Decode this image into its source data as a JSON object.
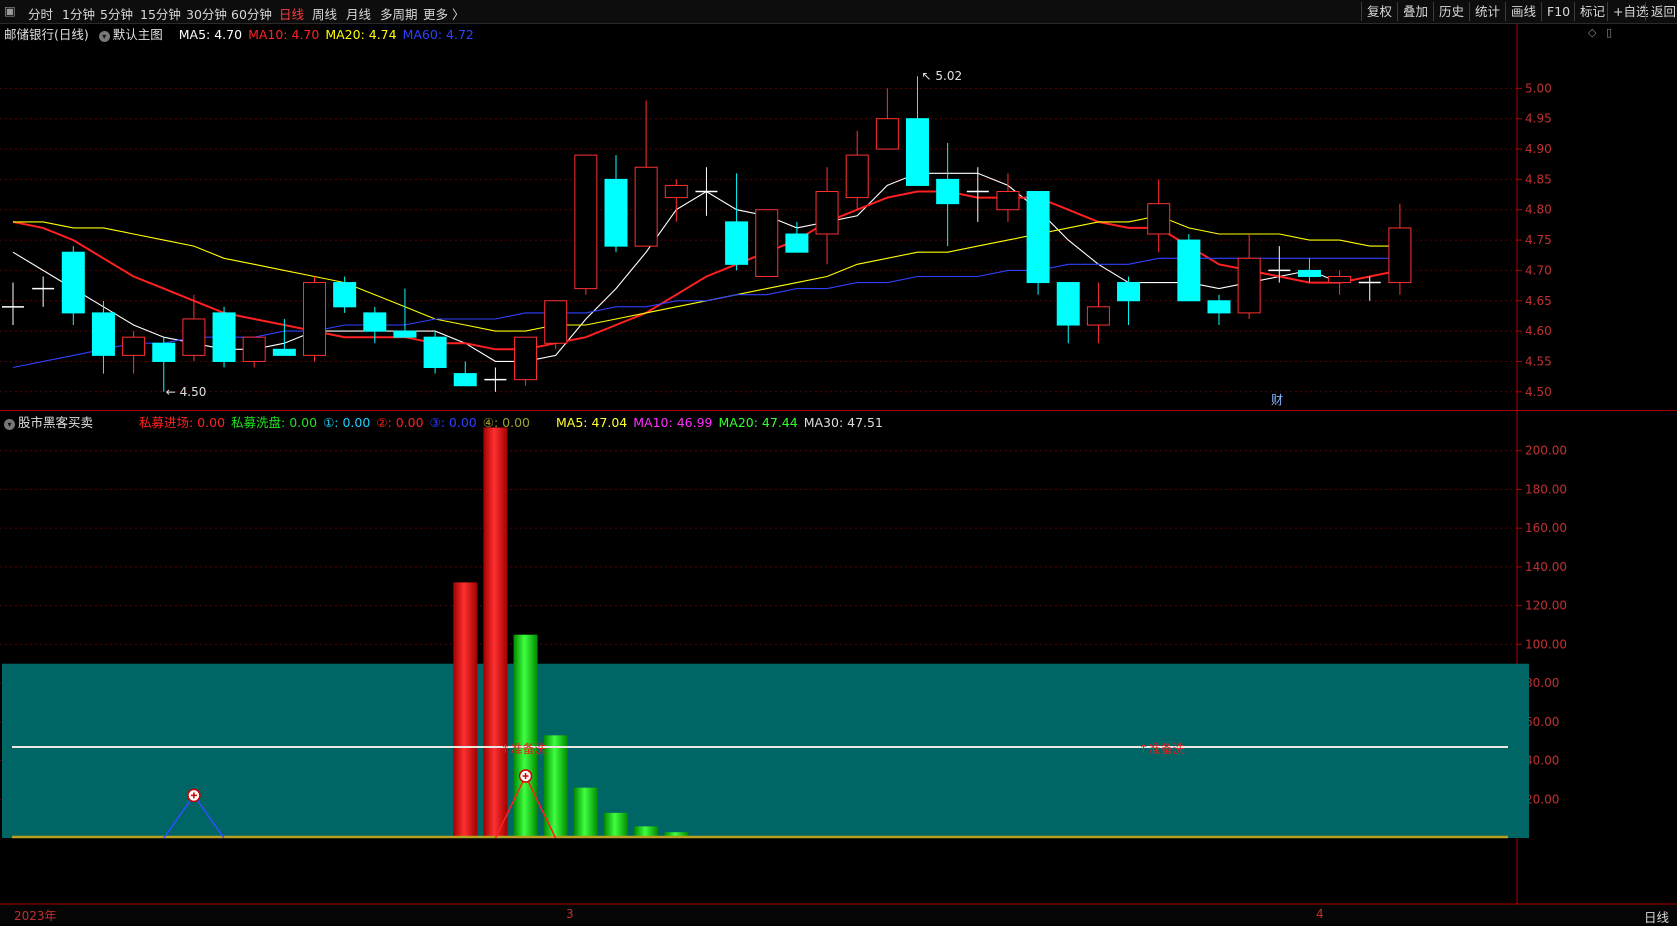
{
  "toolbar": {
    "periods": [
      "分时",
      "1分钟",
      "5分钟",
      "15分钟",
      "30分钟",
      "60分钟",
      "日线",
      "周线",
      "月线",
      "多周期",
      "更多 〉"
    ],
    "active_period": "日线",
    "right_buttons": [
      "复权",
      "叠加",
      "历史",
      "统计",
      "画线",
      "F10",
      "标记",
      "+自选",
      "返回"
    ]
  },
  "main_panel": {
    "title": "邮储银行(日线)",
    "template": "默认主图",
    "ma_labels": [
      {
        "text": "MA5: 4.70",
        "color": "#ffffff"
      },
      {
        "text": "MA10: 4.70",
        "color": "#ff2020"
      },
      {
        "text": "MA20: 4.74",
        "color": "#ffff00"
      },
      {
        "text": "MA60: 4.72",
        "color": "#3040ff"
      }
    ],
    "high_label": "5.02",
    "low_label": "4.50",
    "finance_marker": "财"
  },
  "sub_panel": {
    "title": "股市黑客买卖",
    "labels": [
      {
        "text": "私募进场: 0.00",
        "color": "#ff2020"
      },
      {
        "text": "私募洗盘: 0.00",
        "color": "#20e020"
      },
      {
        "text": "①: 0.00",
        "color": "#20d0ff"
      },
      {
        "text": "②: 0.00",
        "color": "#ff2020"
      },
      {
        "text": "③: 0.00",
        "color": "#3040ff"
      },
      {
        "text": "④: 0.00",
        "color": "#a0a030"
      },
      {
        "text": "MA5: 47.04",
        "color": "#ffff30"
      },
      {
        "text": "MA10: 46.99",
        "color": "#ff30ff"
      },
      {
        "text": "MA20: 47.44",
        "color": "#30ff30"
      },
      {
        "text": "MA30: 47.51",
        "color": "#dddddd"
      }
    ],
    "annotations": [
      "准备洗",
      "准备洗"
    ]
  },
  "timebar": {
    "labels": [
      "2023年",
      "3",
      "4"
    ],
    "period": "日线"
  },
  "chart_data": [
    {
      "type": "candlestick",
      "title": "邮储银行(日线)",
      "ylim": [
        4.47,
        5.05
      ],
      "yticks": [
        4.5,
        4.55,
        4.6,
        4.65,
        4.7,
        4.75,
        4.8,
        4.85,
        4.9,
        4.95,
        5.0
      ],
      "candles": [
        {
          "o": 4.64,
          "h": 4.68,
          "l": 4.61,
          "c": 4.64
        },
        {
          "o": 4.67,
          "h": 4.69,
          "l": 4.64,
          "c": 4.67
        },
        {
          "o": 4.73,
          "h": 4.74,
          "l": 4.61,
          "c": 4.63
        },
        {
          "o": 4.63,
          "h": 4.65,
          "l": 4.53,
          "c": 4.56
        },
        {
          "o": 4.56,
          "h": 4.6,
          "l": 4.53,
          "c": 4.59
        },
        {
          "o": 4.58,
          "h": 4.59,
          "l": 4.5,
          "c": 4.55
        },
        {
          "o": 4.56,
          "h": 4.66,
          "l": 4.55,
          "c": 4.62
        },
        {
          "o": 4.63,
          "h": 4.64,
          "l": 4.54,
          "c": 4.55
        },
        {
          "o": 4.55,
          "h": 4.59,
          "l": 4.54,
          "c": 4.59
        },
        {
          "o": 4.57,
          "h": 4.62,
          "l": 4.56,
          "c": 4.56
        },
        {
          "o": 4.56,
          "h": 4.69,
          "l": 4.55,
          "c": 4.68
        },
        {
          "o": 4.68,
          "h": 4.69,
          "l": 4.63,
          "c": 4.64
        },
        {
          "o": 4.63,
          "h": 4.64,
          "l": 4.58,
          "c": 4.6
        },
        {
          "o": 4.6,
          "h": 4.67,
          "l": 4.59,
          "c": 4.59
        },
        {
          "o": 4.59,
          "h": 4.6,
          "l": 4.53,
          "c": 4.54
        },
        {
          "o": 4.53,
          "h": 4.55,
          "l": 4.51,
          "c": 4.51
        },
        {
          "o": 4.52,
          "h": 4.54,
          "l": 4.5,
          "c": 4.52
        },
        {
          "o": 4.52,
          "h": 4.59,
          "l": 4.51,
          "c": 4.59
        },
        {
          "o": 4.58,
          "h": 4.65,
          "l": 4.57,
          "c": 4.65
        },
        {
          "o": 4.67,
          "h": 4.89,
          "l": 4.66,
          "c": 4.89
        },
        {
          "o": 4.85,
          "h": 4.89,
          "l": 4.73,
          "c": 4.74
        },
        {
          "o": 4.74,
          "h": 4.98,
          "l": 4.74,
          "c": 4.87
        },
        {
          "o": 4.82,
          "h": 4.85,
          "l": 4.78,
          "c": 4.84
        },
        {
          "o": 4.83,
          "h": 4.87,
          "l": 4.79,
          "c": 4.83
        },
        {
          "o": 4.78,
          "h": 4.86,
          "l": 4.7,
          "c": 4.71
        },
        {
          "o": 4.69,
          "h": 4.8,
          "l": 4.69,
          "c": 4.8
        },
        {
          "o": 4.76,
          "h": 4.78,
          "l": 4.73,
          "c": 4.73
        },
        {
          "o": 4.76,
          "h": 4.87,
          "l": 4.71,
          "c": 4.83
        },
        {
          "o": 4.82,
          "h": 4.93,
          "l": 4.8,
          "c": 4.89
        },
        {
          "o": 4.9,
          "h": 5.0,
          "l": 4.9,
          "c": 4.95
        },
        {
          "o": 4.95,
          "h": 5.02,
          "l": 4.84,
          "c": 4.84
        },
        {
          "o": 4.85,
          "h": 4.91,
          "l": 4.74,
          "c": 4.81
        },
        {
          "o": 4.83,
          "h": 4.87,
          "l": 4.78,
          "c": 4.83
        },
        {
          "o": 4.8,
          "h": 4.86,
          "l": 4.78,
          "c": 4.83
        },
        {
          "o": 4.83,
          "h": 4.83,
          "l": 4.66,
          "c": 4.68
        },
        {
          "o": 4.68,
          "h": 4.68,
          "l": 4.58,
          "c": 4.61
        },
        {
          "o": 4.61,
          "h": 4.68,
          "l": 4.58,
          "c": 4.64
        },
        {
          "o": 4.68,
          "h": 4.69,
          "l": 4.61,
          "c": 4.65
        },
        {
          "o": 4.76,
          "h": 4.85,
          "l": 4.73,
          "c": 4.81
        },
        {
          "o": 4.75,
          "h": 4.76,
          "l": 4.65,
          "c": 4.65
        },
        {
          "o": 4.65,
          "h": 4.66,
          "l": 4.61,
          "c": 4.63
        },
        {
          "o": 4.63,
          "h": 4.76,
          "l": 4.62,
          "c": 4.72
        },
        {
          "o": 4.7,
          "h": 4.74,
          "l": 4.68,
          "c": 4.7
        },
        {
          "o": 4.7,
          "h": 4.72,
          "l": 4.68,
          "c": 4.69
        },
        {
          "o": 4.68,
          "h": 4.7,
          "l": 4.66,
          "c": 4.69
        },
        {
          "o": 4.68,
          "h": 4.69,
          "l": 4.65,
          "c": 4.68
        },
        {
          "o": 4.68,
          "h": 4.81,
          "l": 4.66,
          "c": 4.77
        }
      ],
      "series": [
        {
          "name": "MA5",
          "color": "#ffffff",
          "values": [
            4.73,
            4.7,
            4.67,
            4.64,
            4.61,
            4.59,
            4.58,
            4.57,
            4.57,
            4.58,
            4.6,
            4.6,
            4.6,
            4.6,
            4.6,
            4.58,
            4.55,
            4.55,
            4.56,
            4.62,
            4.67,
            4.73,
            4.8,
            4.83,
            4.8,
            4.79,
            4.77,
            4.78,
            4.79,
            4.84,
            4.86,
            4.86,
            4.86,
            4.84,
            4.8,
            4.75,
            4.71,
            4.68,
            4.68,
            4.68,
            4.67,
            4.68,
            4.69,
            4.7,
            4.68,
            4.69,
            4.7
          ]
        },
        {
          "name": "MA10",
          "color": "#ff2020",
          "values": [
            4.78,
            4.77,
            4.75,
            4.72,
            4.69,
            4.67,
            4.65,
            4.63,
            4.62,
            4.61,
            4.6,
            4.59,
            4.59,
            4.59,
            4.58,
            4.58,
            4.57,
            4.57,
            4.58,
            4.59,
            4.61,
            4.63,
            4.66,
            4.69,
            4.71,
            4.73,
            4.75,
            4.78,
            4.8,
            4.82,
            4.83,
            4.83,
            4.82,
            4.82,
            4.82,
            4.8,
            4.78,
            4.77,
            4.77,
            4.74,
            4.71,
            4.7,
            4.69,
            4.68,
            4.68,
            4.69,
            4.7
          ]
        },
        {
          "name": "MA20",
          "color": "#ffff00",
          "values": [
            4.78,
            4.78,
            4.77,
            4.77,
            4.76,
            4.75,
            4.74,
            4.72,
            4.71,
            4.7,
            4.69,
            4.68,
            4.66,
            4.64,
            4.62,
            4.61,
            4.6,
            4.6,
            4.61,
            4.61,
            4.62,
            4.63,
            4.64,
            4.65,
            4.66,
            4.67,
            4.68,
            4.69,
            4.71,
            4.72,
            4.73,
            4.73,
            4.74,
            4.75,
            4.76,
            4.77,
            4.78,
            4.78,
            4.79,
            4.77,
            4.76,
            4.76,
            4.76,
            4.75,
            4.75,
            4.74,
            4.74
          ]
        },
        {
          "name": "MA60",
          "color": "#3040ff",
          "values": [
            4.54,
            4.55,
            4.56,
            4.57,
            4.58,
            4.58,
            4.59,
            4.59,
            4.59,
            4.6,
            4.6,
            4.61,
            4.61,
            4.61,
            4.62,
            4.62,
            4.62,
            4.63,
            4.63,
            4.63,
            4.64,
            4.64,
            4.65,
            4.65,
            4.66,
            4.66,
            4.67,
            4.67,
            4.68,
            4.68,
            4.69,
            4.69,
            4.69,
            4.7,
            4.7,
            4.71,
            4.71,
            4.71,
            4.72,
            4.72,
            4.72,
            4.72,
            4.72,
            4.72,
            4.72,
            4.72,
            4.72
          ]
        }
      ]
    },
    {
      "type": "bar",
      "title": "股市黑客买卖",
      "ylim": [
        0,
        220
      ],
      "yticks": [
        20,
        40,
        60,
        80,
        100,
        120,
        140,
        160,
        180,
        200
      ],
      "band": {
        "from": 0,
        "to": 90
      },
      "bars": [
        {
          "index": 15,
          "value": 132,
          "color": "red"
        },
        {
          "index": 16,
          "value": 212,
          "color": "red"
        },
        {
          "index": 17,
          "value": 105,
          "color": "green"
        },
        {
          "index": 18,
          "value": 53,
          "color": "green"
        },
        {
          "index": 19,
          "value": 26,
          "color": "green"
        },
        {
          "index": 20,
          "value": 13,
          "color": "green"
        },
        {
          "index": 21,
          "value": 6,
          "color": "green"
        },
        {
          "index": 22,
          "value": 3,
          "color": "green"
        },
        {
          "index": 23,
          "value": 1,
          "color": "green"
        }
      ],
      "signals": [
        {
          "index": 6,
          "value": 22,
          "line_color": "#3050ff"
        },
        {
          "index": 17,
          "value": 32,
          "line_color": "#ff2020"
        }
      ],
      "flat_line_value": 47
    }
  ]
}
